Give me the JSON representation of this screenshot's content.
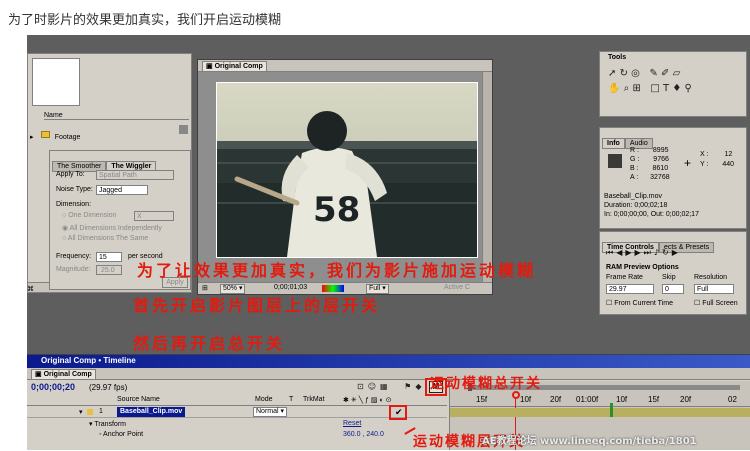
{
  "caption": "为了时影片的效果更加真实，我们开启运动模糊",
  "project": {
    "column_name": "Name",
    "footage": "Footage"
  },
  "wiggler": {
    "tab1": "The Smoother",
    "tab2": "The Wiggler",
    "apply_to_label": "Apply To:",
    "apply_to_value": "Spatial Path",
    "noise_label": "Noise Type:",
    "noise_value": "Jagged",
    "dimension_label": "Dimension:",
    "one_dim": "One Dimension",
    "one_dim_value": "X",
    "all_indep": "All Dimensions Independently",
    "all_same": "All Dimensions The Same",
    "freq_label": "Frequency:",
    "freq_value": "15",
    "freq_unit": "per second",
    "mag_label": "Magnitude:",
    "mag_value": "25.0",
    "apply_btn": "Apply"
  },
  "comp": {
    "title": "Original Comp",
    "zoom": "50%",
    "time": "0;00;01;03",
    "resolution": "Full",
    "camera": "Active C"
  },
  "tools": {
    "title": "Tools"
  },
  "info": {
    "tab1": "Info",
    "tab2": "Audio",
    "r_label": "R :",
    "r_value": "8995",
    "g_label": "G :",
    "g_value": "9766",
    "b_label": "B :",
    "b_value": "8610",
    "a_label": "A :",
    "a_value": "32768",
    "x_label": "X :",
    "x_value": "12",
    "y_label": "Y :",
    "y_value": "440",
    "clip": "Baseball_Clip.mov",
    "duration": "Duration: 0;00;02;18",
    "inout": "In: 0;00;00;00, Out: 0;00;02;17"
  },
  "time_controls": {
    "tab1": "Time Controls",
    "tab2": "ects & Presets",
    "ram_label": "RAM Preview Options",
    "frame_rate_label": "Frame Rate",
    "frame_rate_value": "29.97",
    "skip_label": "Skip",
    "skip_value": "0",
    "resolution_label": "Resolution",
    "resolution_value": "Full",
    "from_current": "From Current Time",
    "full_screen": "Full Screen"
  },
  "timeline": {
    "window_title": "Original Comp • Timeline",
    "tab": "Original Comp",
    "timecode": "0;00;00;20",
    "fps": "(29.97 fps)",
    "col_source": "Source Name",
    "col_mode": "Mode",
    "col_t": "T",
    "col_trkmat": "TrkMat",
    "layer_num": "1",
    "layer_name": "Baseball_Clip.mov",
    "layer_mode": "Normal",
    "transform": "Transform",
    "reset": "Reset",
    "anchor": "Anchor Point",
    "anchor_value": "360.0 , 240.0",
    "m_button": "M",
    "ruler": [
      "15f",
      "10f",
      "20f",
      "01:00f",
      "10f",
      "15f",
      "20f",
      "02"
    ]
  },
  "overlay": {
    "line1": "为了让效果更加真实，我们为影片施加运动模糊",
    "line2": "首先开启影片图层上的层开关",
    "line3": "然后再开启总开关",
    "label_master": "运动模糊总开关",
    "label_layer": "运动模糊层开关"
  },
  "watermark": "AE教程论坛 www.lineeq.com/tieba/1801",
  "colors": {
    "annotation": "#e31b0f",
    "timeline_blue": "#0a1a8c",
    "layer_green": "#2c8f2c"
  }
}
